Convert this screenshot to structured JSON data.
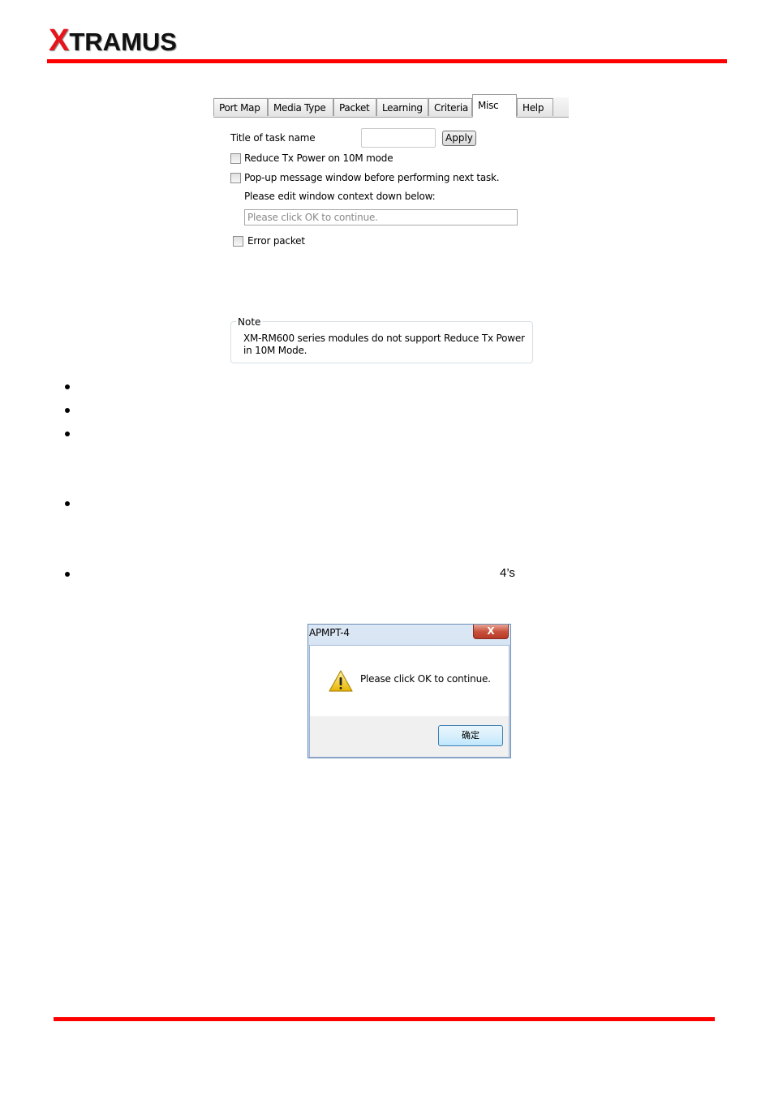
{
  "header": {
    "logo_x": "X",
    "logo_rest": "TRAMUS",
    "accent_color": "#ff0000"
  },
  "panel": {
    "tabs": [
      {
        "label": "Port Map"
      },
      {
        "label": "Media Type"
      },
      {
        "label": "Packet"
      },
      {
        "label": "Learning"
      },
      {
        "label": "Criteria"
      },
      {
        "label": "Misc",
        "active": true
      },
      {
        "label": "Help"
      }
    ],
    "title_label": "Title of task name",
    "title_value": "",
    "apply_label": "Apply",
    "reduce_tx_label": "Reduce Tx Power on 10M mode",
    "reduce_tx_checked": false,
    "popup_label": "Pop-up message window before performing next task.",
    "popup_checked": false,
    "edit_label": "Please edit window context down below:",
    "message_placeholder": "Please click OK to continue.",
    "error_packet_label": "Error packet",
    "error_packet_checked": false,
    "note_legend": "Note",
    "note_text": "XM-RM600 series modules do not support Reduce Tx Power in 10M Mode."
  },
  "body_text": {
    "fragment": "4’s"
  },
  "dialog": {
    "title": "APMPT-4",
    "close_glyph": "X",
    "icon": "warning-icon",
    "message": "Please click OK to continue.",
    "ok_label": "确定"
  }
}
